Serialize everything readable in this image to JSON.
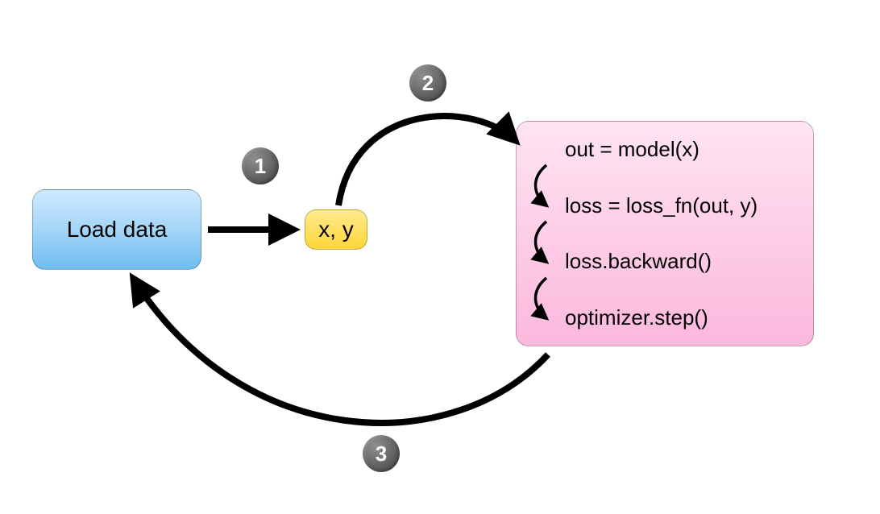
{
  "nodes": {
    "load": "Load data",
    "xy": "x, y",
    "code": {
      "line1": "out = model(x)",
      "line2": "loss = loss_fn(out, y)",
      "line3": "loss.backward()",
      "line4": "optimizer.step()"
    }
  },
  "steps": {
    "s1": "1",
    "s2": "2",
    "s3": "3"
  }
}
